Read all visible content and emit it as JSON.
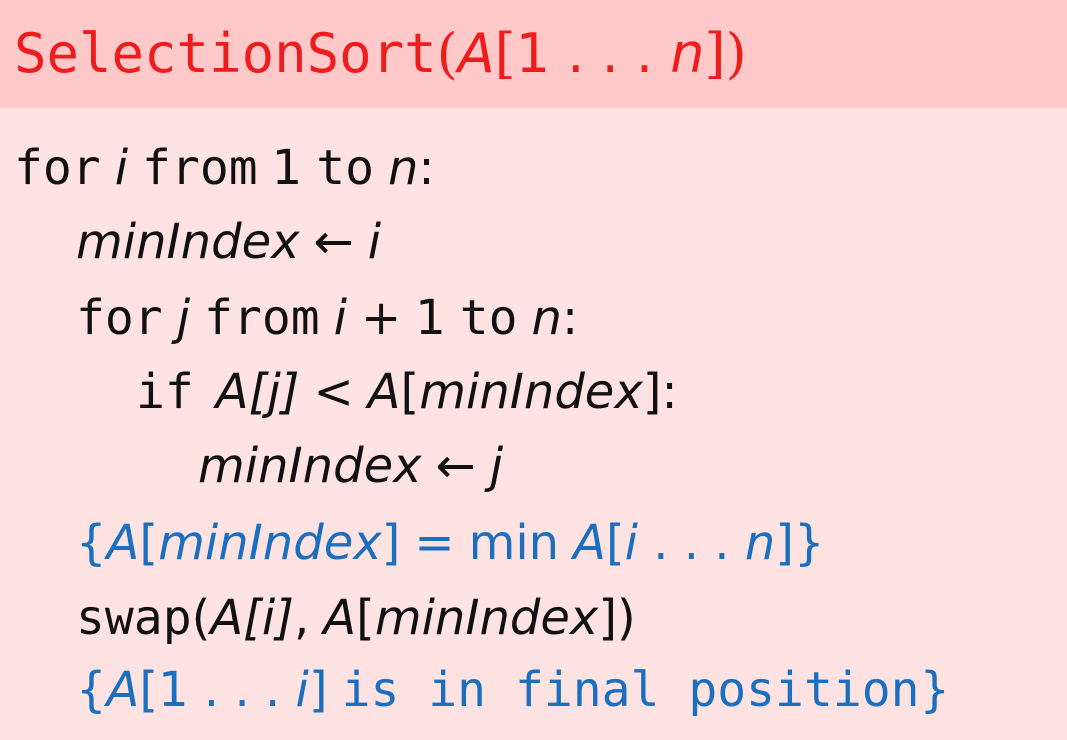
{
  "title": {
    "name": "SelectionSort",
    "paren_open": "(",
    "array": "A",
    "bracket_open": "[",
    "start": "1",
    "dots": " . . . ",
    "end": "n",
    "bracket_close": "]",
    "paren_close": ")"
  },
  "lines": {
    "l1": {
      "kw_for": "for",
      "var_i": "i",
      "kw_from": "from",
      "num_1": "1",
      "kw_to": "to",
      "var_n": "n",
      "colon": ":"
    },
    "l2": {
      "var": "minIndex",
      "arrow": "←",
      "val": "i"
    },
    "l3": {
      "kw_for": "for",
      "var_j": "j",
      "kw_from": "from",
      "expr_i": "i",
      "plus": "+",
      "num_1": "1",
      "kw_to": "to",
      "var_n": "n",
      "colon": ":"
    },
    "l4": {
      "kw_if": "if",
      "A1": "A",
      "idx1": "[j]",
      "lt": "<",
      "A2": "A",
      "lb": "[",
      "idx2": "minIndex",
      "rb": "]",
      "colon": ":"
    },
    "l5": {
      "var": "minIndex",
      "arrow": "←",
      "val": "j"
    },
    "l6": {
      "lbrace": "{",
      "A1": "A",
      "lb1": "[",
      "idx1": "minIndex",
      "rb1": "]",
      "eq": "=",
      "min": "min",
      "A2": "A",
      "lb2": "[",
      "i": "i",
      "dots": " . . . ",
      "n": "n",
      "rb2": "]",
      "rbrace": "}"
    },
    "l7": {
      "kw_swap": "swap",
      "lp": "(",
      "A1": "A",
      "idx1": "[i]",
      "comma": ",",
      "A2": "A",
      "lb": "[",
      "idx2": "minIndex",
      "rb": "]",
      "rp": ")"
    },
    "l8": {
      "lbrace": "{",
      "A": "A",
      "lb": "[",
      "one": "1",
      "dots": " . . . ",
      "i": "i",
      "rb": "]",
      "text": "is in final position",
      "rbrace": "}"
    }
  }
}
